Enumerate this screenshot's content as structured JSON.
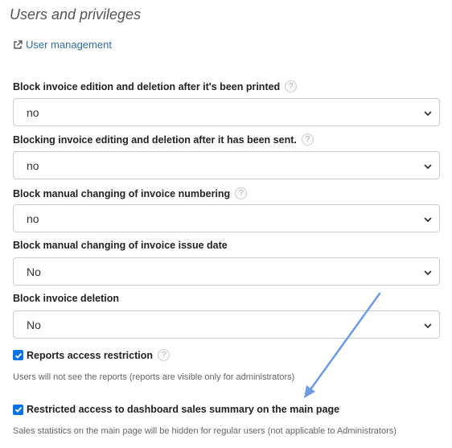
{
  "section": {
    "title": "Users and privileges",
    "user_management_link": "User management"
  },
  "fields": [
    {
      "label": "Block invoice edition and deletion after it's been printed",
      "value": "no",
      "has_help": true
    },
    {
      "label": "Blocking invoice editing and deletion after it has been sent.",
      "value": "no",
      "has_help": true
    },
    {
      "label": "Block manual changing of invoice numbering",
      "value": "no",
      "has_help": true
    },
    {
      "label": "Block manual changing of invoice issue date",
      "value": "No",
      "has_help": false
    },
    {
      "label": "Block invoice deletion",
      "value": "No",
      "has_help": false
    }
  ],
  "checkboxes": [
    {
      "label": "Reports access restriction",
      "checked": true,
      "has_help": true,
      "hint": "Users will not see the reports (reports are visible only for administrators)"
    },
    {
      "label": "Restricted access to dashboard sales summary on the main page",
      "checked": true,
      "has_help": false,
      "hint": "Sales statistics on the main page will be hidden for regular users (not applicable to Administrators)"
    }
  ],
  "help_symbol": "?",
  "colors": {
    "link": "#2e6da4",
    "checkbox": "#0b73e0",
    "annotation_arrow": "#6f9ae0"
  }
}
